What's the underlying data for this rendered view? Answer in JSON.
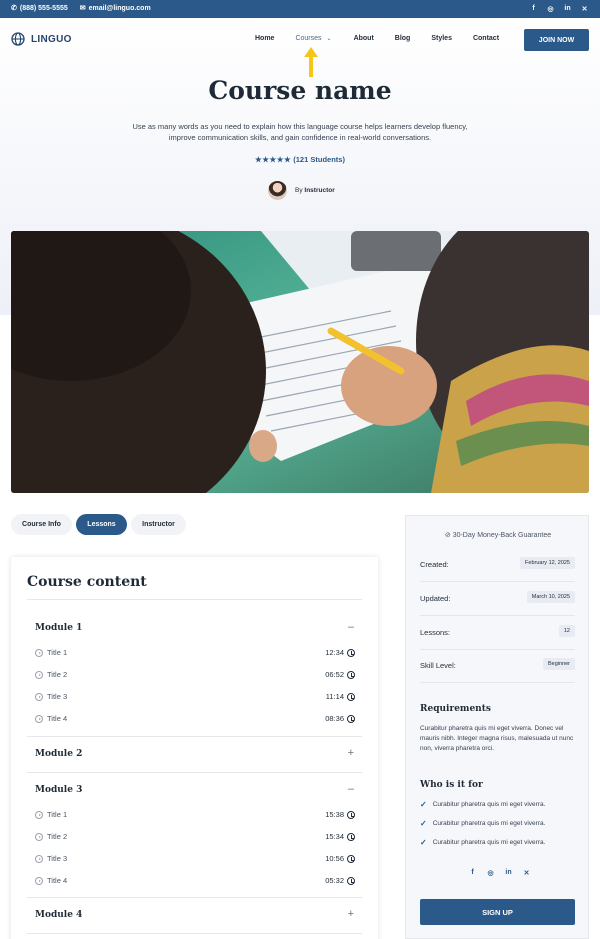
{
  "topbar": {
    "phone": "(888) 555-5555",
    "email": "email@linguo.com",
    "socials": [
      "facebook-icon",
      "instagram-icon",
      "linkedin-icon",
      "x-icon"
    ]
  },
  "header": {
    "logo": "LINGUO",
    "nav": [
      "Home",
      "Courses",
      "About",
      "Blog",
      "Styles",
      "Contact"
    ],
    "cta": "JOIN NOW"
  },
  "hero": {
    "title": "Course name",
    "description": "Use as many words as you need to explain how this language course helps learners develop fluency, improve communication skills, and gain confidence in real-world conversations.",
    "stars": "★★★★★",
    "students": "(121 Students)",
    "by": "By",
    "instructor": "Instructor"
  },
  "tabs": [
    "Course Info",
    "Lessons",
    "Instructor"
  ],
  "content": {
    "title": "Course content",
    "modules": [
      {
        "name": "Module 1",
        "toggle": "–",
        "lessons": [
          {
            "title": "Title 1",
            "duration": "12:34"
          },
          {
            "title": "Title 2",
            "duration": "06:52"
          },
          {
            "title": "Title 3",
            "duration": "11:14"
          },
          {
            "title": "Title 4",
            "duration": "08:36"
          }
        ]
      },
      {
        "name": "Module 2",
        "toggle": "+",
        "lessons": []
      },
      {
        "name": "Module 3",
        "toggle": "–",
        "lessons": [
          {
            "title": "Title 1",
            "duration": "15:38"
          },
          {
            "title": "Title 2",
            "duration": "15:34"
          },
          {
            "title": "Title 3",
            "duration": "10:56"
          },
          {
            "title": "Title 4",
            "duration": "05:32"
          }
        ]
      },
      {
        "name": "Module 4",
        "toggle": "+",
        "lessons": []
      }
    ]
  },
  "sidebar": {
    "guarantee": "30-Day Money-Back Guarantee",
    "info": [
      {
        "label": "Created:",
        "value": "February 12, 2025"
      },
      {
        "label": "Updated:",
        "value": "March 10, 2025"
      },
      {
        "label": "Lessons:",
        "value": "12"
      },
      {
        "label": "Skill Level:",
        "value": "Beginner"
      }
    ],
    "requirements_title": "Requirements",
    "requirements_text": "Curabitur pharetra quis mi eget viverra. Donec vel mauris nibh. Integer magna risus, malesuada ut nunc non, viverra pharetra orci.",
    "who_title": "Who is it for",
    "who_items": [
      "Curabitur pharetra quis mi eget viverra.",
      "Curabitur pharetra quis mi eget viverra.",
      "Curabitur pharetra quis mi eget viverra."
    ],
    "signup": "SIGN UP"
  },
  "colors": {
    "brand": "#2b5a8a",
    "arrow": "#f5c518"
  }
}
